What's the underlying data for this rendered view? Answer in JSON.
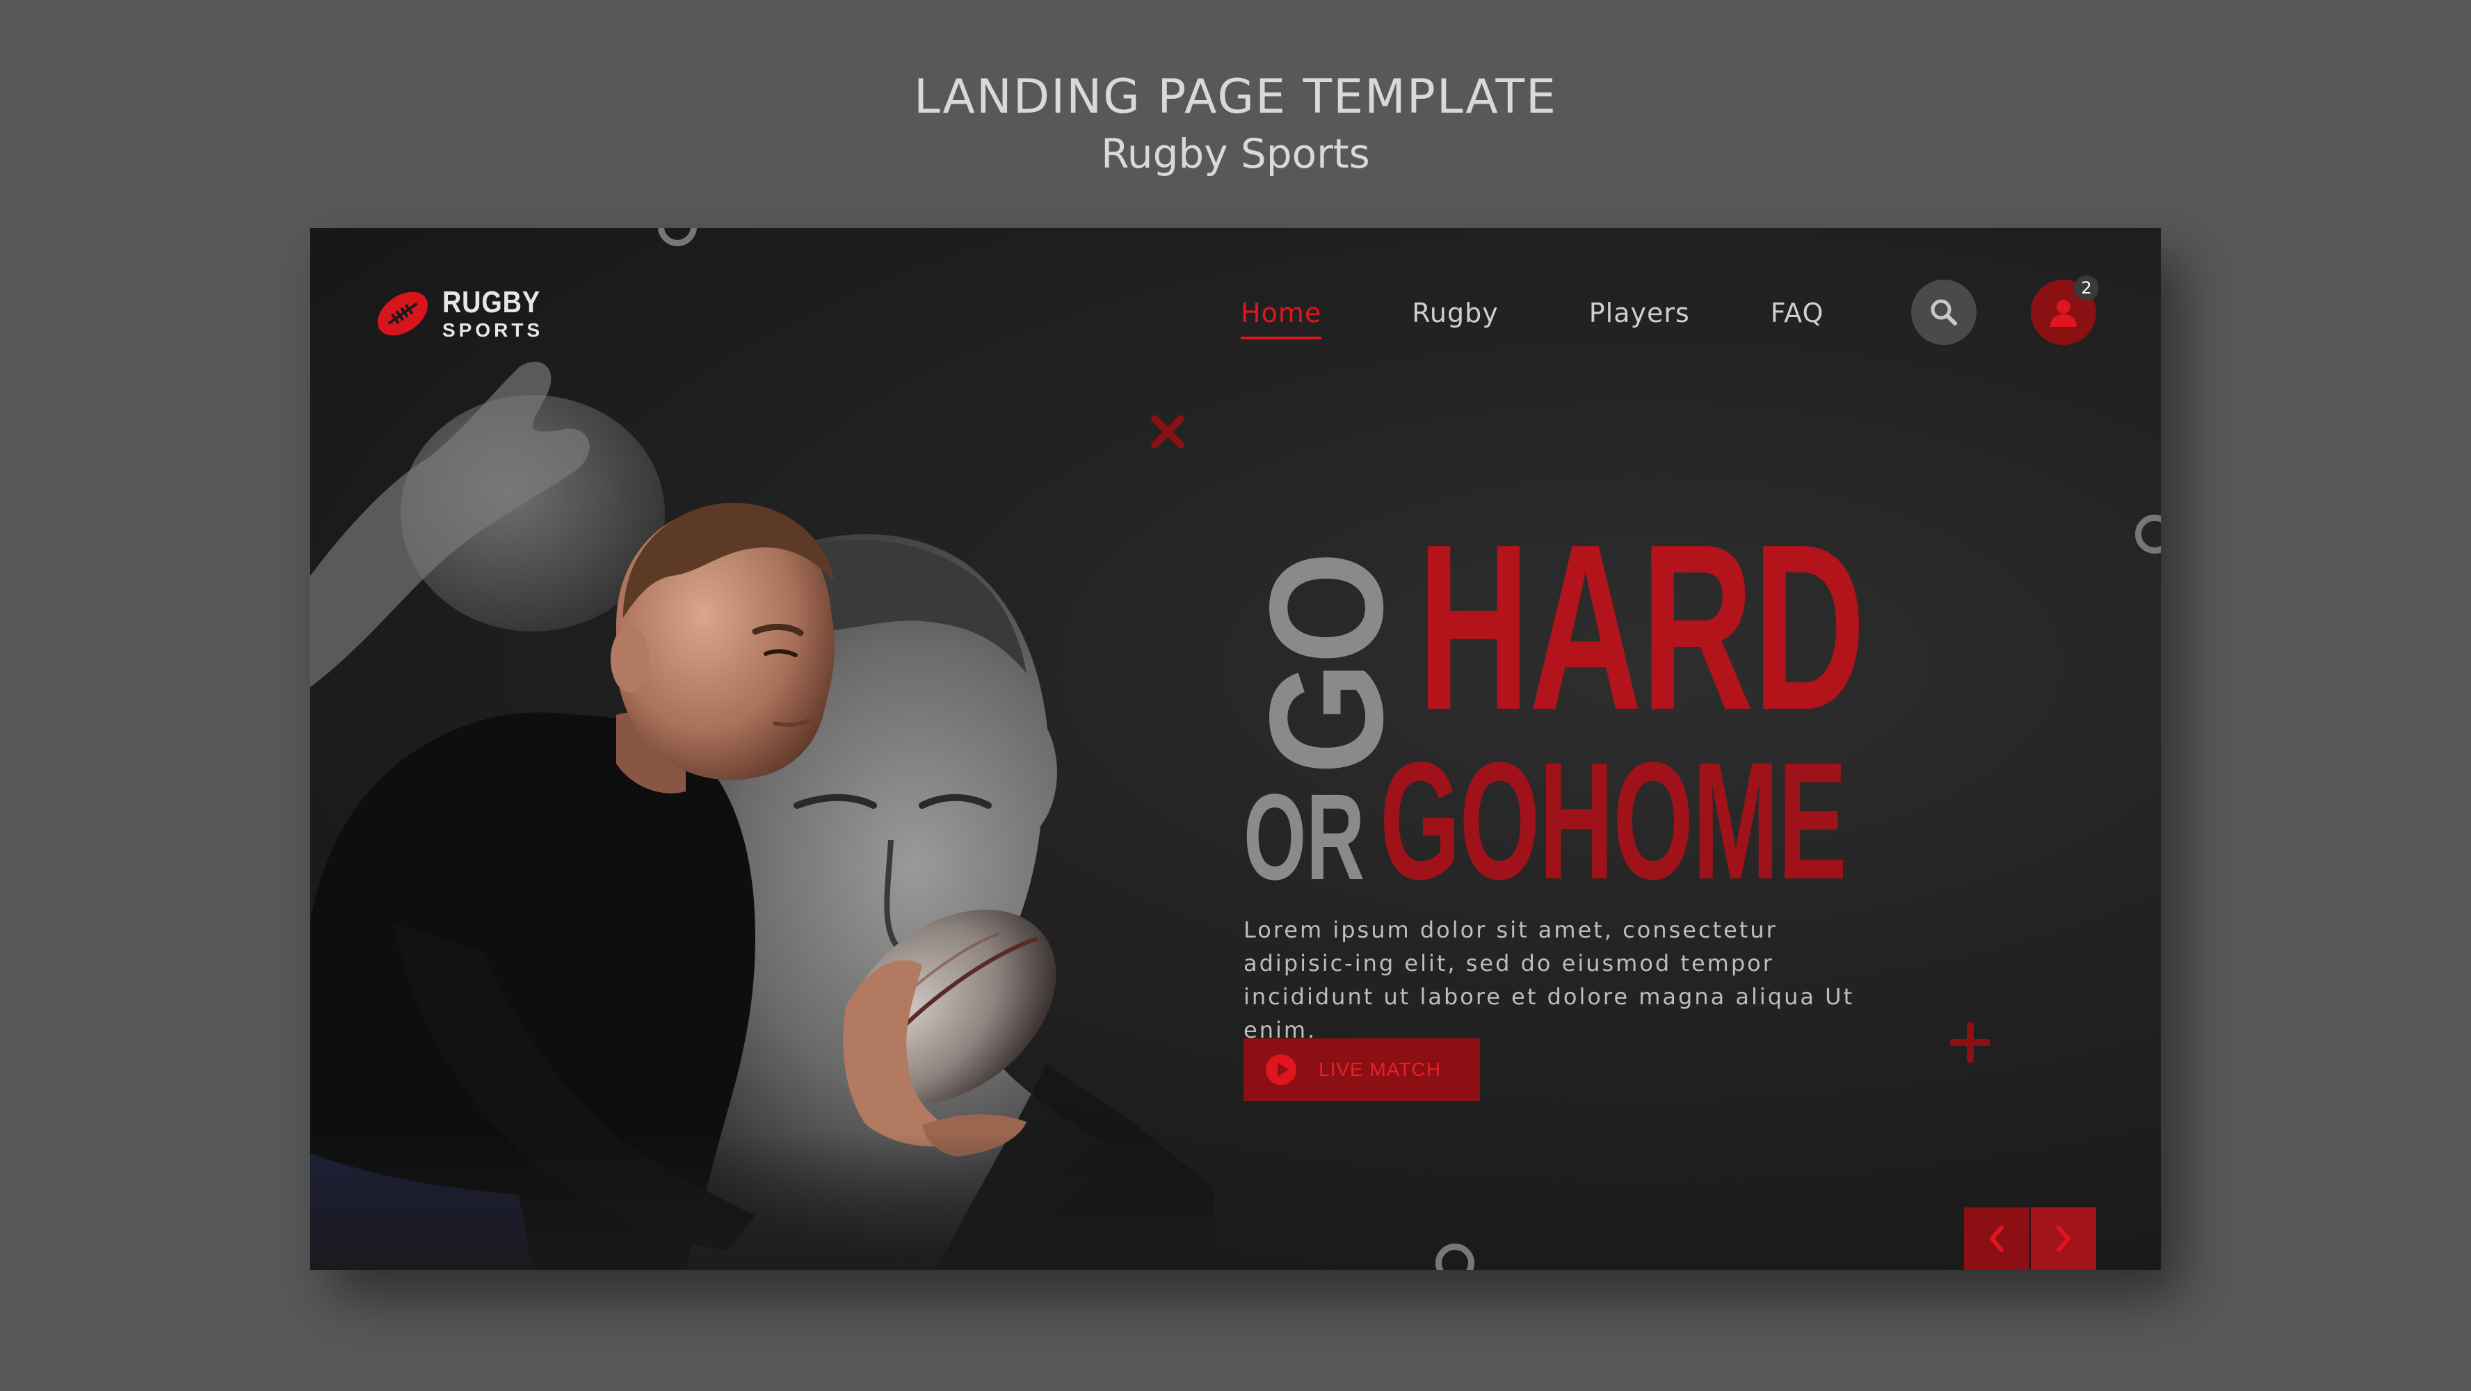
{
  "showcase": {
    "title": "LANDING PAGE TEMPLATE",
    "subtitle": "Rugby Sports"
  },
  "brand": {
    "name": "RUGBY",
    "tagline": "SPORTS",
    "logo_icon": "rugby-ball-icon",
    "accent_color": "#e0151e"
  },
  "nav": {
    "items": [
      {
        "label": "Home",
        "active": true
      },
      {
        "label": "Rugby",
        "active": false
      },
      {
        "label": "Players",
        "active": false
      },
      {
        "label": "FAQ",
        "active": false
      }
    ],
    "search_icon": "search-icon",
    "user_icon": "user-icon",
    "notification_count": "2"
  },
  "hero": {
    "headline_go": "GO",
    "headline_hard": "HARD",
    "headline_or": "OR",
    "headline_gohome": "GOHOME",
    "body": "Lorem ipsum dolor sit amet, consectetur adipisic-ing elit, sed do eiusmod tempor incididunt ut labore et dolore magna aliqua Ut enim.",
    "cta_label": "LIVE MATCH",
    "cta_icon": "play-icon"
  },
  "pager": {
    "prev_icon": "chevron-left-icon",
    "next_icon": "chevron-right-icon"
  }
}
